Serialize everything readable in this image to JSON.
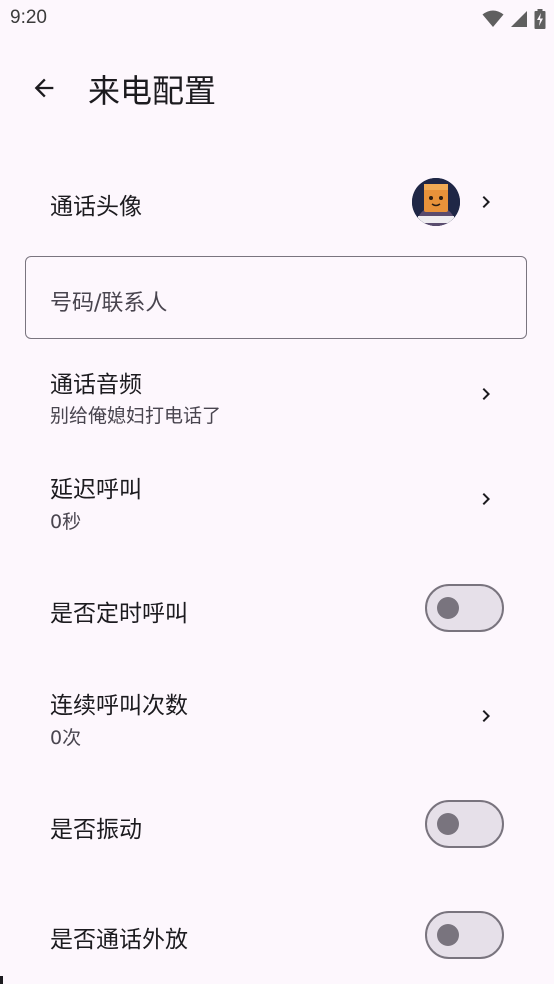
{
  "status_bar": {
    "time": "9:20",
    "icons": [
      "wifi-icon",
      "signal-icon",
      "battery-charging-icon"
    ]
  },
  "app_bar": {
    "back_icon": "arrow-left-icon",
    "title": "来电配置"
  },
  "settings": {
    "avatar_row": {
      "label": "通话头像",
      "avatar_icon": "avatar-image",
      "chevron_icon": "chevron-right-icon"
    },
    "number_field": {
      "placeholder": "号码/联系人",
      "value": ""
    },
    "audio_row": {
      "label": "通话音频",
      "value": "别给俺媳妇打电话了",
      "chevron_icon": "chevron-right-icon"
    },
    "delay_row": {
      "label": "延迟呼叫",
      "value": "0秒",
      "chevron_icon": "chevron-right-icon"
    },
    "timed_call_row": {
      "label": "是否定时呼叫",
      "checked": false
    },
    "repeat_row": {
      "label": "连续呼叫次数",
      "value": "0次",
      "chevron_icon": "chevron-right-icon"
    },
    "vibrate_row": {
      "label": "是否振动",
      "checked": false
    },
    "speaker_row": {
      "label": "是否通话外放",
      "checked": false
    }
  },
  "colors": {
    "background": "#fdf7fd",
    "text_primary": "#1c1b1f",
    "text_secondary": "#49454f",
    "outline": "#79747e",
    "switch_track": "#e6e0e9"
  }
}
